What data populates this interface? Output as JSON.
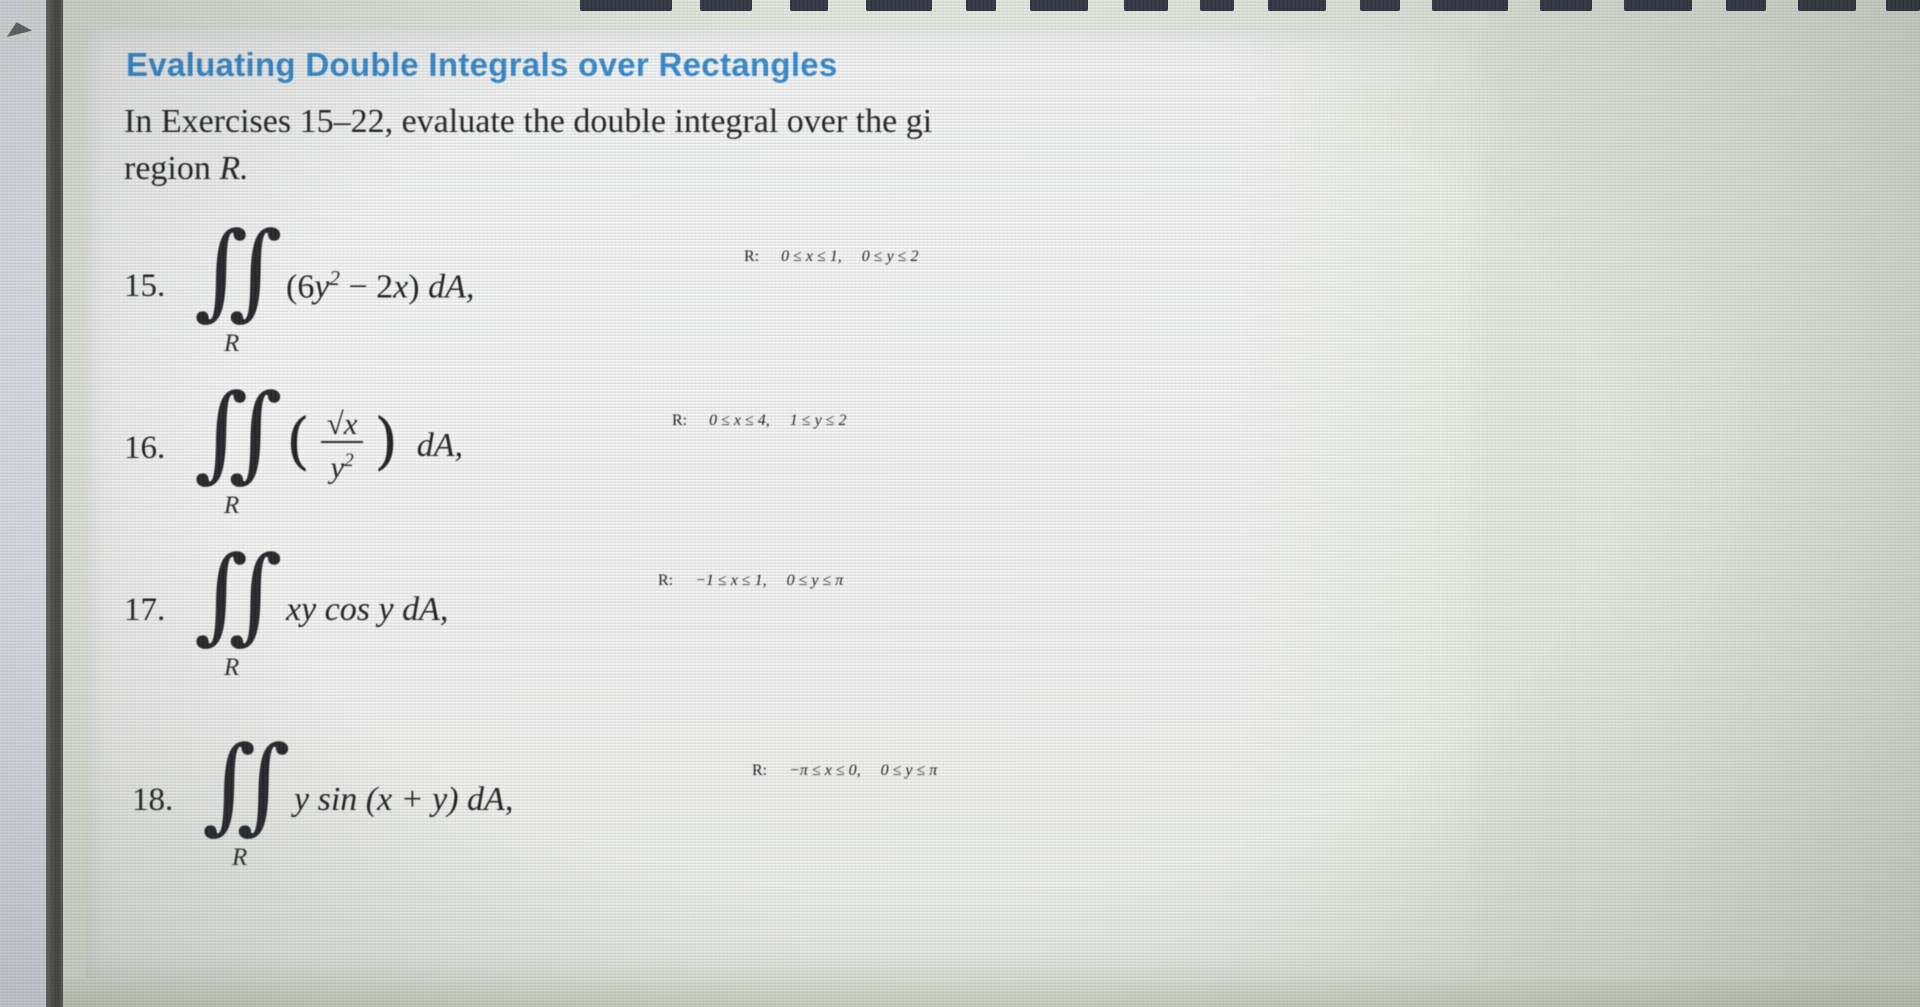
{
  "document": {
    "heading": "Evaluating Double Integrals over Rectangles",
    "intro_line1": "In Exercises 15–22, evaluate the double integral over the gi",
    "intro_line2_prefix": "region ",
    "intro_line2_italic": "R."
  },
  "colors": {
    "heading_blue": "#2f88cf",
    "body_text": "#1d1d20",
    "paper": "#f3f4f3",
    "page_tint": "#e6eadf",
    "dark_bar": "#4c4c4a"
  },
  "exercises": [
    {
      "number": "15.",
      "integral_symbol": "∬",
      "subscript": "R",
      "integrand_prefix": "(6",
      "integrand_var1": "y",
      "integrand_exp": "2",
      "integrand_mid": " − 2",
      "integrand_var2": "x",
      "integrand_suffix": ") ",
      "differential": "dA,",
      "region_label": "R:",
      "region": "0 ≤ x ≤ 1,  0 ≤ y ≤ 2"
    },
    {
      "number": "16.",
      "integral_symbol": "∬",
      "subscript": "R",
      "fraction_numerator": "√x",
      "fraction_denominator_var": "y",
      "fraction_denominator_exp": "2",
      "differential": "dA,",
      "region_label": "R:",
      "region": "0 ≤ x ≤ 4,  1 ≤ y ≤ 2"
    },
    {
      "number": "17.",
      "integral_symbol": "∬",
      "subscript": "R",
      "integrand": "xy cos y ",
      "differential": "dA,",
      "region_label": "R:",
      "region": "−1 ≤ x ≤ 1,  0 ≤ y ≤ π"
    },
    {
      "number": "18.",
      "integral_symbol": "∬",
      "subscript": "R",
      "integrand": "y sin (x + y) ",
      "differential": "dA,",
      "region_label": "R:",
      "region": "−π ≤ x ≤ 0,  0 ≤ y ≤ π"
    }
  ]
}
